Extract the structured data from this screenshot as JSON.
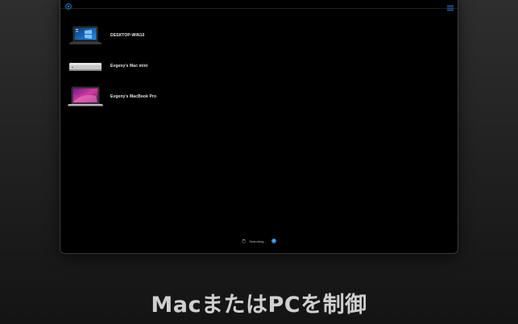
{
  "devices": [
    {
      "name": "DESKTOP-WIN10",
      "icon": "windows-laptop-icon"
    },
    {
      "name": "Evgeny's Mac mini",
      "icon": "mac-mini-icon"
    },
    {
      "name": "Evgeny's MacBook Pro",
      "icon": "macbook-pro-icon"
    }
  ],
  "status": {
    "text": "Searching..."
  },
  "caption": "MacまたはPCを制御",
  "colors": {
    "window_bg": "#000000",
    "accent": "#2f7fd9",
    "caption": "#cfcfcf"
  }
}
